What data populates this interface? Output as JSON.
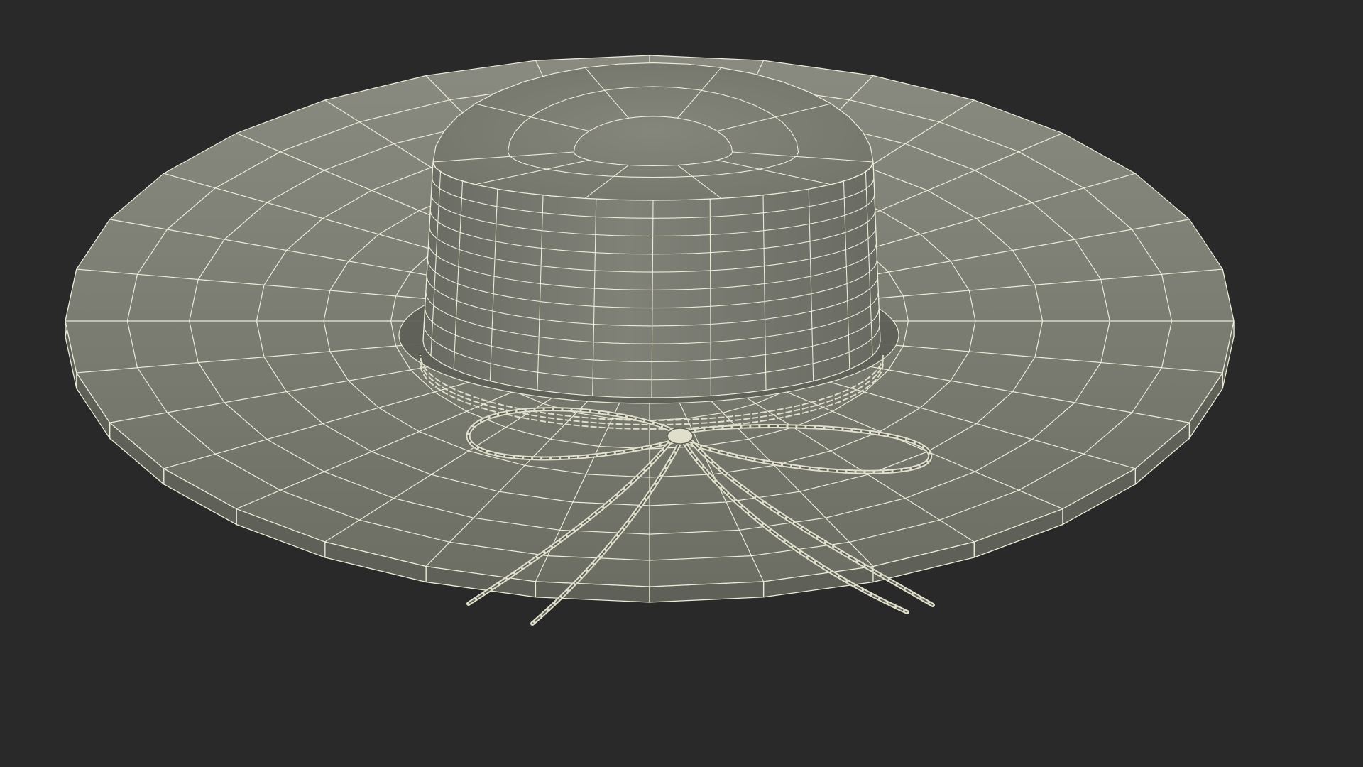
{
  "scene": {
    "subject": "wide-brim-hat-wireframe",
    "background_color": "#292929",
    "surface_color": "#7a7b70",
    "surface_shadow_color": "#5f6158",
    "surface_highlight_color": "#8c8d82",
    "wire_color": "#ecebd9",
    "cord_color": "#e0dfcc"
  }
}
